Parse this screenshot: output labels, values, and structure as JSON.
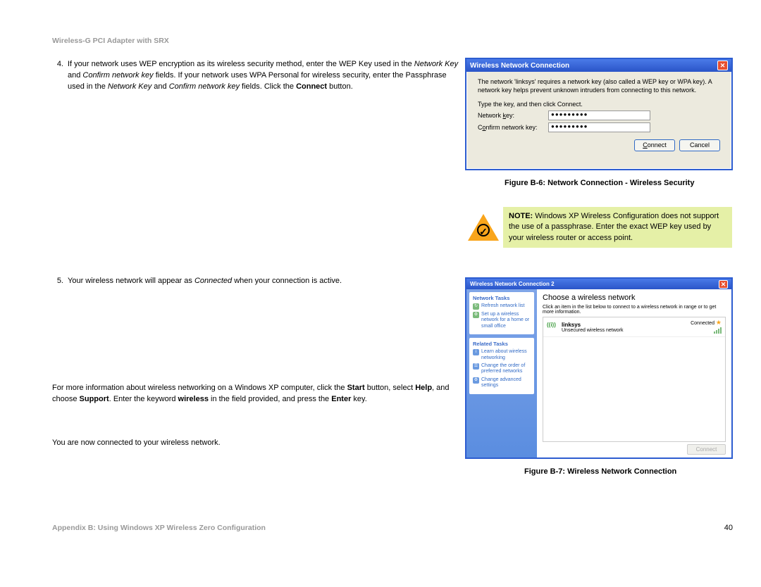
{
  "header": "Wireless-G PCI Adapter with SRX",
  "step4": {
    "num": "4.",
    "p1a": "If your network uses WEP encryption as its wireless security method, enter the WEP Key used in the ",
    "nk": "Network Key",
    "and1": " and ",
    "cnk": "Confirm network key",
    "p1b": " fields. If your network uses WPA Personal for wireless security, enter the Passphrase used in the ",
    "and2": " and ",
    "p1c": " fields. Click the ",
    "connect": "Connect",
    "p1d": " button."
  },
  "step5": {
    "num": "5.",
    "p1a": "Your wireless network will appear as ",
    "conn": "Connected",
    "p1b": " when your connection is active."
  },
  "para_info": {
    "a": "For more information about wireless networking on a Windows XP computer, click the ",
    "start": "Start",
    "b": " button, select ",
    "help": "Help",
    "c": ", and choose ",
    "support": "Support",
    "d": ". Enter the keyword ",
    "wireless": "wireless",
    "e": " in the field provided, and press the ",
    "enter": "Enter",
    "f": " key."
  },
  "para_conn": "You are now connected to your wireless network.",
  "dlg1": {
    "title": "Wireless Network Connection",
    "text1": "The network 'linksys' requires a network key (also called a WEP key or WPA key). A network key helps prevent unknown intruders from connecting to this network.",
    "text2": "Type the key, and then click Connect.",
    "lbl_nk": "Network key:",
    "lbl_cnk": "Confirm network key:",
    "val": "●●●●●●●●●",
    "btn_connect": "Connect",
    "btn_cancel": "Cancel"
  },
  "cap1": "Figure B-6: Network Connection - Wireless Security",
  "note": {
    "label": "NOTE:",
    "text": " Windows XP Wireless Configuration does not support the use of a passphrase. Enter the exact WEP key used by your wireless router or access point.",
    "tick": "✓"
  },
  "dlg2": {
    "title": "Wireless Network Connection 2",
    "left_h1": "Network Tasks",
    "left_i1": "Refresh network list",
    "left_i2": "Set up a wireless network for a home or small office",
    "left_h2": "Related Tasks",
    "left_i3": "Learn about wireless networking",
    "left_i4": "Change the order of preferred networks",
    "left_i5": "Change advanced settings",
    "heading": "Choose a wireless network",
    "sub": "Click an item in the list below to connect to a wireless network in range or to get more information.",
    "ssid": "linksys",
    "status": "Connected",
    "sec": "Unsecured wireless network",
    "btn": "Connect"
  },
  "cap2": "Figure B-7: Wireless Network Connection",
  "footer_left": "Appendix B: Using Windows XP Wireless Zero Configuration",
  "footer_right": "40"
}
